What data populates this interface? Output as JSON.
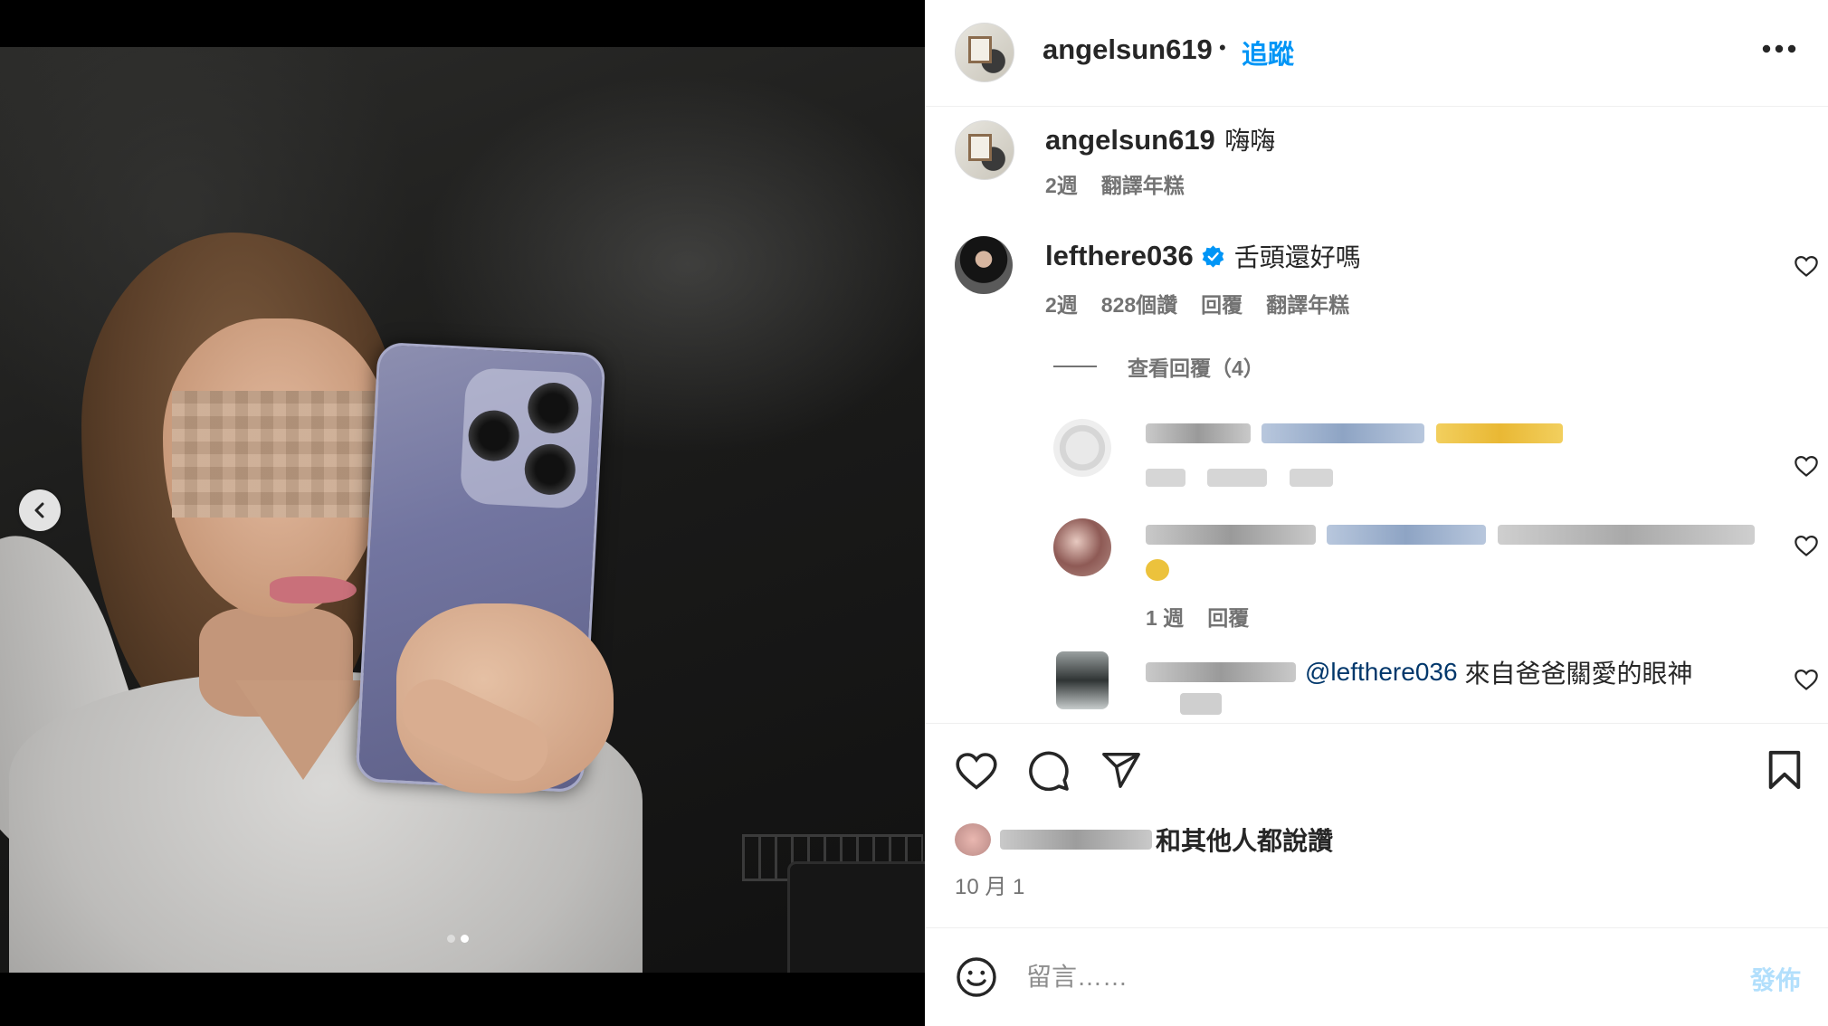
{
  "post": {
    "author": "angelsun619",
    "follow_label": "追蹤",
    "separator": "•",
    "more_icon": "more-horizontal-icon"
  },
  "caption": {
    "username": "angelsun619",
    "text": "嗨嗨",
    "time": "2週",
    "translate": "翻譯年糕"
  },
  "comment": {
    "username": "lefthere036",
    "verified_icon": "verified-badge-icon",
    "text": "舌頭還好嗎",
    "time": "2週",
    "likes": "828個讚",
    "reply": "回覆",
    "translate": "翻譯年糕",
    "view_replies": "查看回覆（4）"
  },
  "replies": [
    {
      "text": "",
      "meta": []
    },
    {
      "text": "",
      "meta": [
        "1 週",
        "回覆"
      ]
    },
    {
      "mention": "@lefthere036",
      "text": "來自爸爸關愛的眼神",
      "meta": []
    }
  ],
  "actions": {
    "like_icon": "heart-icon",
    "comment_icon": "comment-icon",
    "share_icon": "send-icon",
    "save_icon": "bookmark-icon"
  },
  "likes_summary": {
    "suffix": "和其他人都說讚"
  },
  "date": "10 月 1",
  "comment_box": {
    "emoji_icon": "emoji-icon",
    "placeholder": "留言……",
    "post_label": "發佈"
  },
  "colors": {
    "accent_blue": "#0095f6",
    "mention_blue": "#00376b",
    "post_button_disabled": "#b2dffc",
    "secondary_text": "#737373",
    "verified": "#0095f6"
  }
}
